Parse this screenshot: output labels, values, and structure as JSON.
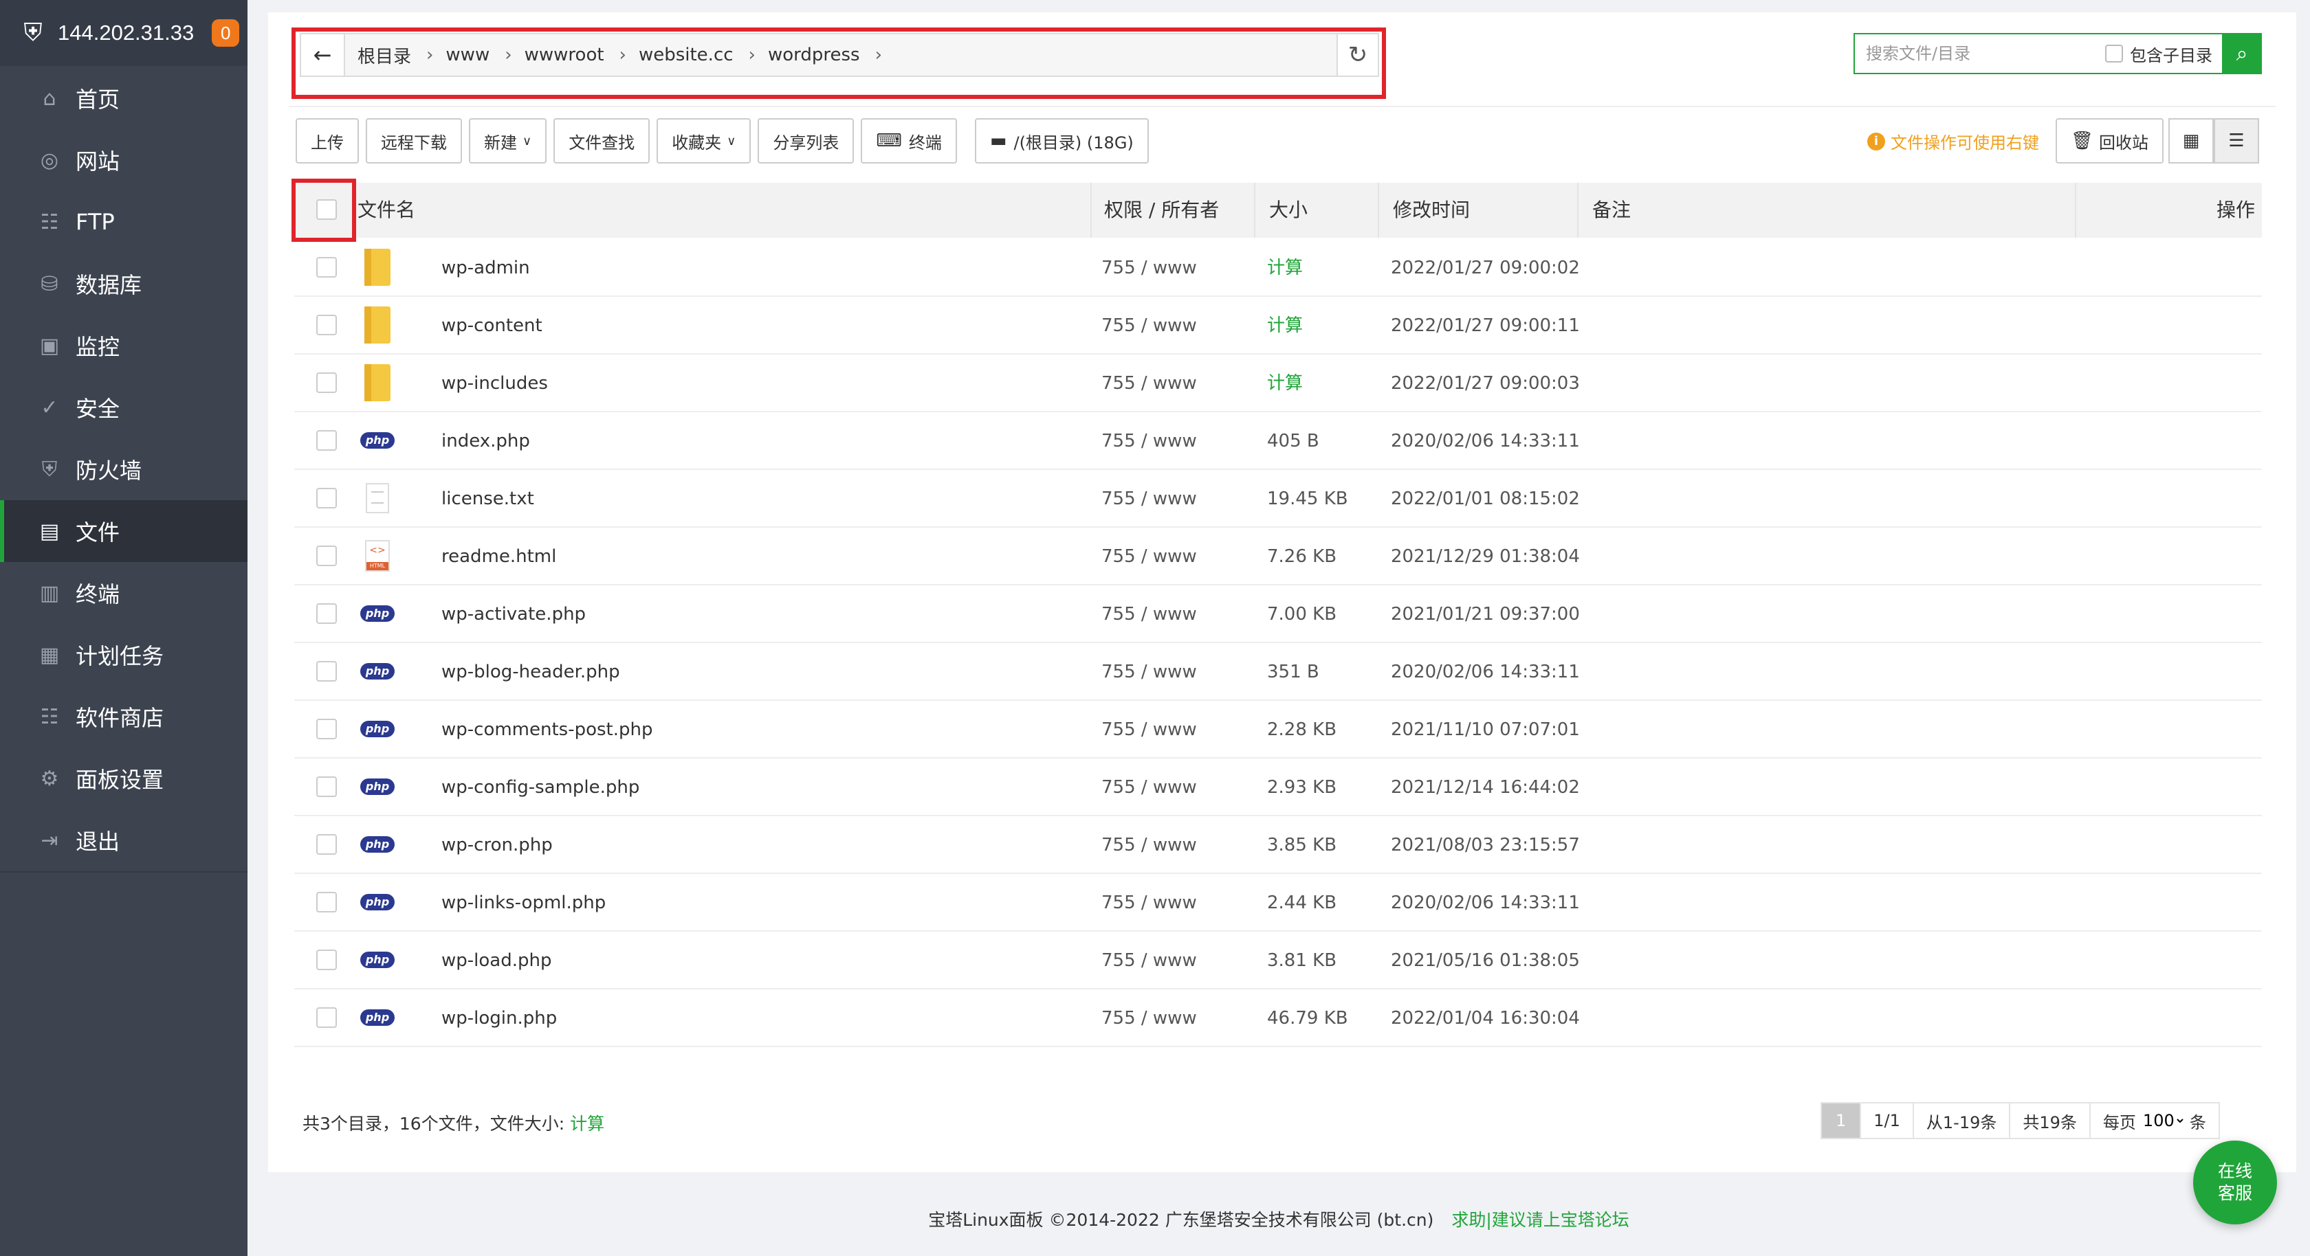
{
  "sidebar": {
    "server_ip": "144.202.31.33",
    "badge_count": "0",
    "items": [
      {
        "label": "首页",
        "icon": "home-icon"
      },
      {
        "label": "网站",
        "icon": "globe-icon"
      },
      {
        "label": "FTP",
        "icon": "ftp-icon"
      },
      {
        "label": "数据库",
        "icon": "database-icon"
      },
      {
        "label": "监控",
        "icon": "monitor-icon"
      },
      {
        "label": "安全",
        "icon": "shield-check-icon"
      },
      {
        "label": "防火墙",
        "icon": "firewall-icon"
      },
      {
        "label": "文件",
        "icon": "folder-icon",
        "active": true
      },
      {
        "label": "终端",
        "icon": "terminal-icon"
      },
      {
        "label": "计划任务",
        "icon": "calendar-icon"
      },
      {
        "label": "软件商店",
        "icon": "apps-icon"
      },
      {
        "label": "面板设置",
        "icon": "gear-icon"
      },
      {
        "label": "退出",
        "icon": "logout-icon"
      }
    ]
  },
  "breadcrumb": [
    "根目录",
    "www",
    "wwwroot",
    "website.cc",
    "wordpress"
  ],
  "search": {
    "placeholder": "搜索文件/目录",
    "include_subdir_label": "包含子目录"
  },
  "toolbar": {
    "upload": "上传",
    "remote_download": "远程下载",
    "new": "新建",
    "file_search": "文件查找",
    "favorites": "收藏夹",
    "share_list": "分享列表",
    "terminal": "终端",
    "disk": "/(根目录) (18G)",
    "tip": "文件操作可使用右键",
    "recycle": "回收站"
  },
  "table": {
    "headers": {
      "name": "文件名",
      "perm": "权限 / 所有者",
      "size": "大小",
      "mtime": "修改时间",
      "note": "备注",
      "ops": "操作"
    },
    "rows": [
      {
        "name": "wp-admin",
        "type": "folder",
        "perm": "755 / www",
        "size": "计算",
        "mtime": "2022/01/27 09:00:02"
      },
      {
        "name": "wp-content",
        "type": "folder",
        "perm": "755 / www",
        "size": "计算",
        "mtime": "2022/01/27 09:00:11"
      },
      {
        "name": "wp-includes",
        "type": "folder",
        "perm": "755 / www",
        "size": "计算",
        "mtime": "2022/01/27 09:00:03"
      },
      {
        "name": "index.php",
        "type": "php",
        "perm": "755 / www",
        "size": "405 B",
        "mtime": "2020/02/06 14:33:11"
      },
      {
        "name": "license.txt",
        "type": "txt",
        "perm": "755 / www",
        "size": "19.45 KB",
        "mtime": "2022/01/01 08:15:02"
      },
      {
        "name": "readme.html",
        "type": "html",
        "perm": "755 / www",
        "size": "7.26 KB",
        "mtime": "2021/12/29 01:38:04"
      },
      {
        "name": "wp-activate.php",
        "type": "php",
        "perm": "755 / www",
        "size": "7.00 KB",
        "mtime": "2021/01/21 09:37:00"
      },
      {
        "name": "wp-blog-header.php",
        "type": "php",
        "perm": "755 / www",
        "size": "351 B",
        "mtime": "2020/02/06 14:33:11"
      },
      {
        "name": "wp-comments-post.php",
        "type": "php",
        "perm": "755 / www",
        "size": "2.28 KB",
        "mtime": "2021/11/10 07:07:01"
      },
      {
        "name": "wp-config-sample.php",
        "type": "php",
        "perm": "755 / www",
        "size": "2.93 KB",
        "mtime": "2021/12/14 16:44:02"
      },
      {
        "name": "wp-cron.php",
        "type": "php",
        "perm": "755 / www",
        "size": "3.85 KB",
        "mtime": "2021/08/03 23:15:57"
      },
      {
        "name": "wp-links-opml.php",
        "type": "php",
        "perm": "755 / www",
        "size": "2.44 KB",
        "mtime": "2020/02/06 14:33:11"
      },
      {
        "name": "wp-load.php",
        "type": "php",
        "perm": "755 / www",
        "size": "3.81 KB",
        "mtime": "2021/05/16 01:38:05"
      },
      {
        "name": "wp-login.php",
        "type": "php",
        "perm": "755 / www",
        "size": "46.79 KB",
        "mtime": "2022/01/04 16:30:04"
      }
    ]
  },
  "footer": {
    "summary": "共3个目录，16个文件，文件大小:",
    "calc_link": "计算",
    "pager": {
      "current": "1",
      "pages": "1/1",
      "range": "从1-19条",
      "total": "共19条",
      "per_page_label": "每页",
      "per_page_value": "100",
      "unit": "条"
    }
  },
  "copyright": {
    "text": "宝塔Linux面板 ©2014-2022 广东堡塔安全技术有限公司 (bt.cn)",
    "link": "求助|建议请上宝塔论坛"
  },
  "chat_button": "在线\n客服",
  "colors": {
    "accent": "#20a53a",
    "highlight_box": "#e0242b",
    "sidebar_bg": "#3d4450",
    "badge": "#f0781c"
  }
}
